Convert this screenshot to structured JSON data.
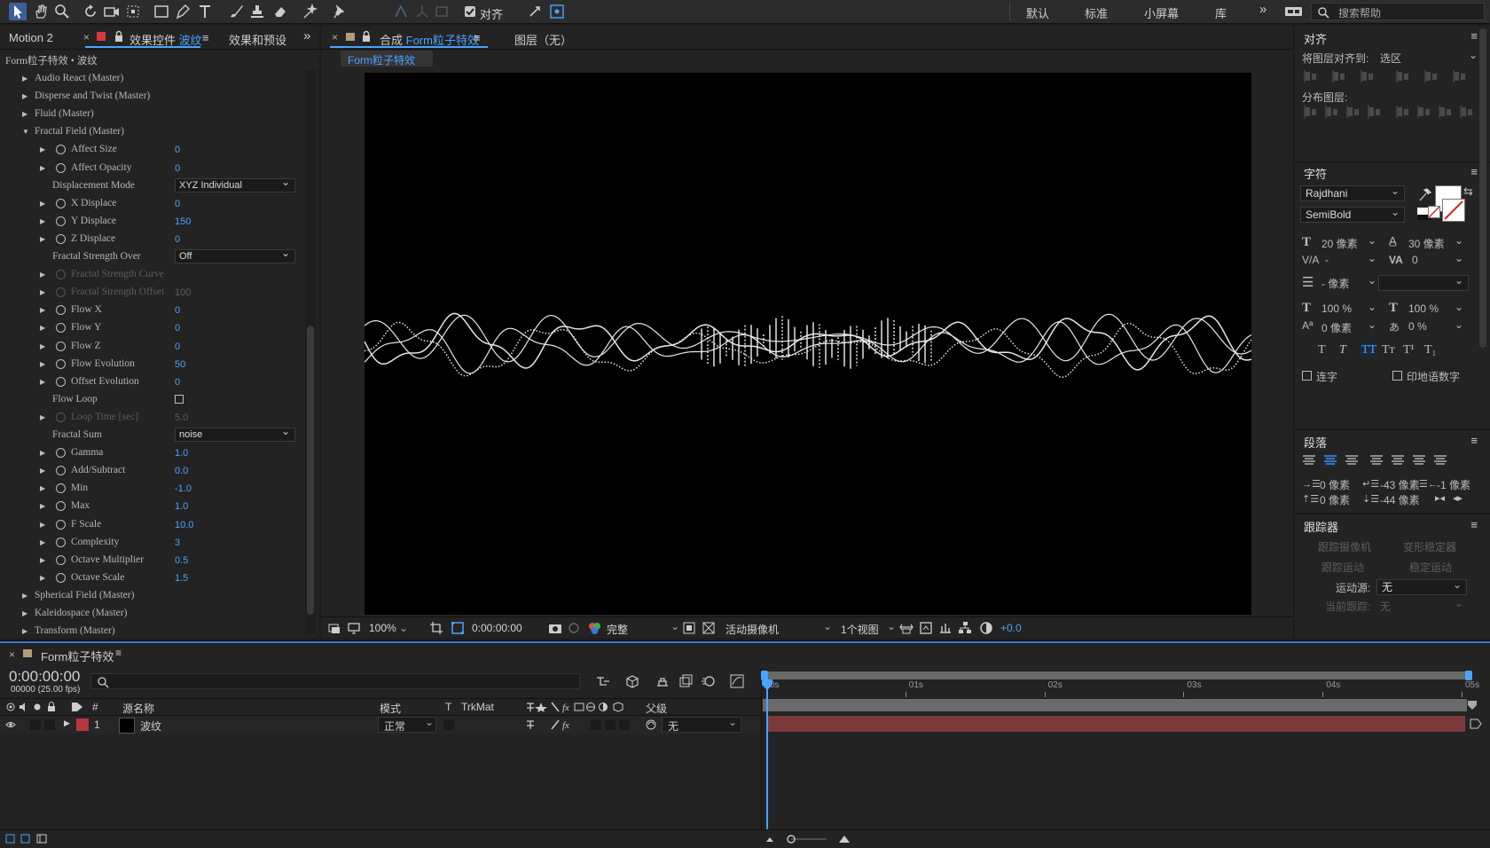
{
  "toolbar": {
    "align_checkbox_label": "对齐",
    "workspaces": [
      "默认",
      "标准",
      "小屏幕",
      "库"
    ],
    "search_placeholder": "搜索帮助"
  },
  "left_panel": {
    "tab_project": "Motion 2",
    "tab_effects_prefix": "效果控件",
    "tab_effects_layer": "波纹",
    "tab_presets": "效果和预设",
    "breadcrumb": "Form粒子特效 • 波纹",
    "properties": [
      {
        "name": "Audio React (Master)",
        "level": 0,
        "expanded": false
      },
      {
        "name": "Disperse and Twist (Master)",
        "level": 0,
        "expanded": false
      },
      {
        "name": "Fluid (Master)",
        "level": 0,
        "expanded": false
      },
      {
        "name": "Fractal Field (Master)",
        "level": 0,
        "expanded": true
      },
      {
        "name": "Affect Size",
        "level": 1,
        "value": "0"
      },
      {
        "name": "Affect Opacity",
        "level": 1,
        "value": "0"
      },
      {
        "name": "Displacement Mode",
        "level": 2,
        "select": "XYZ Individual"
      },
      {
        "name": "X Displace",
        "level": 1,
        "value": "0"
      },
      {
        "name": "Y Displace",
        "level": 1,
        "value": "150"
      },
      {
        "name": "Z Displace",
        "level": 1,
        "value": "0"
      },
      {
        "name": "Fractal Strength Over",
        "level": 2,
        "select": "Off"
      },
      {
        "name": "Fractal Strength Curve",
        "level": 1,
        "disabled": true
      },
      {
        "name": "Fractal Strength Offset",
        "level": 1,
        "value": "100",
        "disabled": true
      },
      {
        "name": "Flow X",
        "level": 1,
        "value": "0"
      },
      {
        "name": "Flow Y",
        "level": 1,
        "value": "0"
      },
      {
        "name": "Flow Z",
        "level": 1,
        "value": "0"
      },
      {
        "name": "Flow Evolution",
        "level": 1,
        "value": "50"
      },
      {
        "name": "Offset Evolution",
        "level": 1,
        "value": "0"
      },
      {
        "name": "Flow Loop",
        "level": 2,
        "checkbox": true
      },
      {
        "name": "Loop Time [sec]",
        "level": 1,
        "value": "5.0",
        "disabled": true
      },
      {
        "name": "Fractal Sum",
        "level": 2,
        "select": "noise"
      },
      {
        "name": "Gamma",
        "level": 1,
        "value": "1.0"
      },
      {
        "name": "Add/Subtract",
        "level": 1,
        "value": "0.0"
      },
      {
        "name": "Min",
        "level": 1,
        "value": "-1.0"
      },
      {
        "name": "Max",
        "level": 1,
        "value": "1.0"
      },
      {
        "name": "F Scale",
        "level": 1,
        "value": "10.0"
      },
      {
        "name": "Complexity",
        "level": 1,
        "value": "3"
      },
      {
        "name": "Octave Multiplier",
        "level": 1,
        "value": "0.5"
      },
      {
        "name": "Octave Scale",
        "level": 1,
        "value": "1.5"
      },
      {
        "name": "Spherical Field (Master)",
        "level": 0,
        "expanded": false
      },
      {
        "name": "Kaleidospace (Master)",
        "level": 0,
        "expanded": false
      },
      {
        "name": "Transform (Master)",
        "level": 0,
        "expanded": false
      }
    ]
  },
  "comp_panel": {
    "tab_comp_prefix": "合成",
    "tab_comp_name": "Form粒子特效",
    "tab_layer": "图层（无）",
    "sub_tab": "Form粒子特效",
    "zoom": "100%",
    "timecode": "0:00:00:00",
    "resolution": "完整",
    "camera": "活动摄像机",
    "views": "1个视图",
    "exposure": "+0.0"
  },
  "right_panel": {
    "align_title": "对齐",
    "align_to_label": "将图层对齐到:",
    "align_to_value": "选区",
    "distribute_label": "分布图层:",
    "char_title": "字符",
    "font_family": "Rajdhani",
    "font_style": "SemiBold",
    "font_size": "20 像素",
    "leading": "30 像素",
    "kerning": "-",
    "tracking": "0",
    "stroke_width": "- 像素",
    "vscale": "100 %",
    "hscale": "100 %",
    "baseline": "0 像素",
    "tsume": "0 %",
    "ligature_label": "连字",
    "hindi_digits_label": "印地语数字",
    "para_title": "段落",
    "indent_left": "0 像素",
    "indent_first": "-43 像素",
    "indent_right": "-1 像素",
    "space_before": "0 像素",
    "space_after": "-44 像素",
    "tracker_title": "跟踪器",
    "track_camera": "跟踪摄像机",
    "warp_stabilizer": "变形稳定器",
    "track_motion": "跟踪运动",
    "stabilize_motion": "稳定运动",
    "motion_source_label": "运动源:",
    "motion_source_value": "无",
    "current_track_label": "当前跟踪:",
    "current_track_value": "无"
  },
  "timeline": {
    "comp_name": "Form粒子特效",
    "timecode": "0:00:00:00",
    "frames": "00000 (25.00 fps)",
    "ruler": [
      "0s",
      "01s",
      "02s",
      "03s",
      "04s",
      "05s"
    ],
    "col_hash": "#",
    "col_source": "源名称",
    "col_mode": "模式",
    "col_t": "T",
    "col_trkmat": "TrkMat",
    "col_parent": "父级",
    "layer_number": "1",
    "layer_name": "波纹",
    "layer_mode": "正常",
    "layer_parent": "无",
    "layer_color": "#b5383f",
    "bar_color": "#7a3a3c",
    "accent": "#4aa3ff"
  }
}
